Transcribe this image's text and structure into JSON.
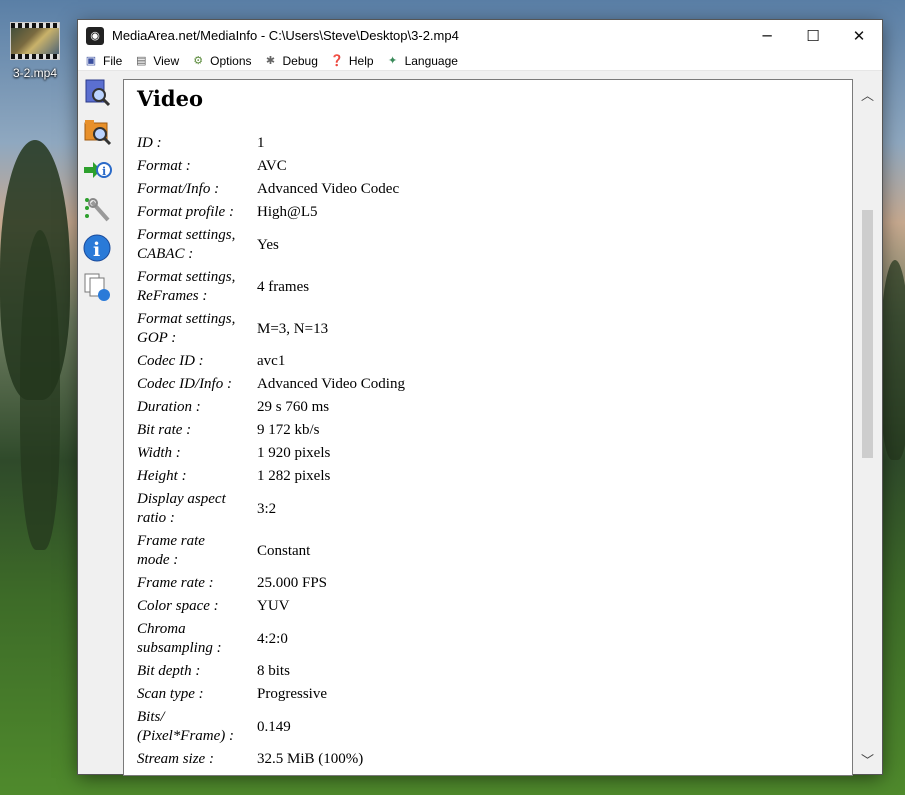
{
  "desktop": {
    "icon_label": "3-2.mp4"
  },
  "window": {
    "title": "MediaArea.net/MediaInfo - C:\\Users\\Steve\\Desktop\\3-2.mp4",
    "minimize": "─",
    "maximize": "☐",
    "close": "✕"
  },
  "menu": [
    "File",
    "View",
    "Options",
    "Debug",
    "Help",
    "Language"
  ],
  "section_title": "Video",
  "fields": [
    {
      "k1": "ID :",
      "k2": "",
      "v": "1"
    },
    {
      "k1": "Format :",
      "k2": "",
      "v": "AVC"
    },
    {
      "k1": "Format/Info :",
      "k2": "",
      "v": "Advanced Video Codec"
    },
    {
      "k1": "Format profile :",
      "k2": "",
      "v": "High@L5"
    },
    {
      "k1": "Format settings,",
      "k2": "CABAC :",
      "v": "Yes"
    },
    {
      "k1": "Format settings,",
      "k2": "ReFrames :",
      "v": "4 frames"
    },
    {
      "k1": "Format settings,",
      "k2": "GOP :",
      "v": "M=3, N=13"
    },
    {
      "k1": "Codec ID :",
      "k2": "",
      "v": "avc1"
    },
    {
      "k1": "Codec ID/Info :",
      "k2": "",
      "v": "Advanced Video Coding"
    },
    {
      "k1": "Duration :",
      "k2": "",
      "v": "29 s 760 ms"
    },
    {
      "k1": "Bit rate :",
      "k2": "",
      "v": "9 172 kb/s"
    },
    {
      "k1": "Width :",
      "k2": "",
      "v": "1 920 pixels"
    },
    {
      "k1": "Height :",
      "k2": "",
      "v": "1 282 pixels"
    },
    {
      "k1": "Display aspect",
      "k2": "ratio :",
      "v": "3:2"
    },
    {
      "k1": "Frame rate",
      "k2": "mode :",
      "v": "Constant"
    },
    {
      "k1": "Frame rate :",
      "k2": "",
      "v": "25.000 FPS"
    },
    {
      "k1": "Color space :",
      "k2": "",
      "v": "YUV"
    },
    {
      "k1": "Chroma",
      "k2": "subsampling :",
      "v": "4:2:0"
    },
    {
      "k1": "Bit depth :",
      "k2": "",
      "v": "8 bits"
    },
    {
      "k1": "Scan type :",
      "k2": "",
      "v": "Progressive"
    },
    {
      "k1": "Bits/",
      "k2": "(Pixel*Frame) :",
      "v": "0.149"
    },
    {
      "k1": "Stream size :",
      "k2": "",
      "v": "32.5 MiB (100%)"
    }
  ],
  "icons": {
    "toolbar": [
      "open-file-icon",
      "open-folder-icon",
      "export-icon",
      "preferences-icon",
      "about-icon",
      "copy-info-icon"
    ]
  }
}
